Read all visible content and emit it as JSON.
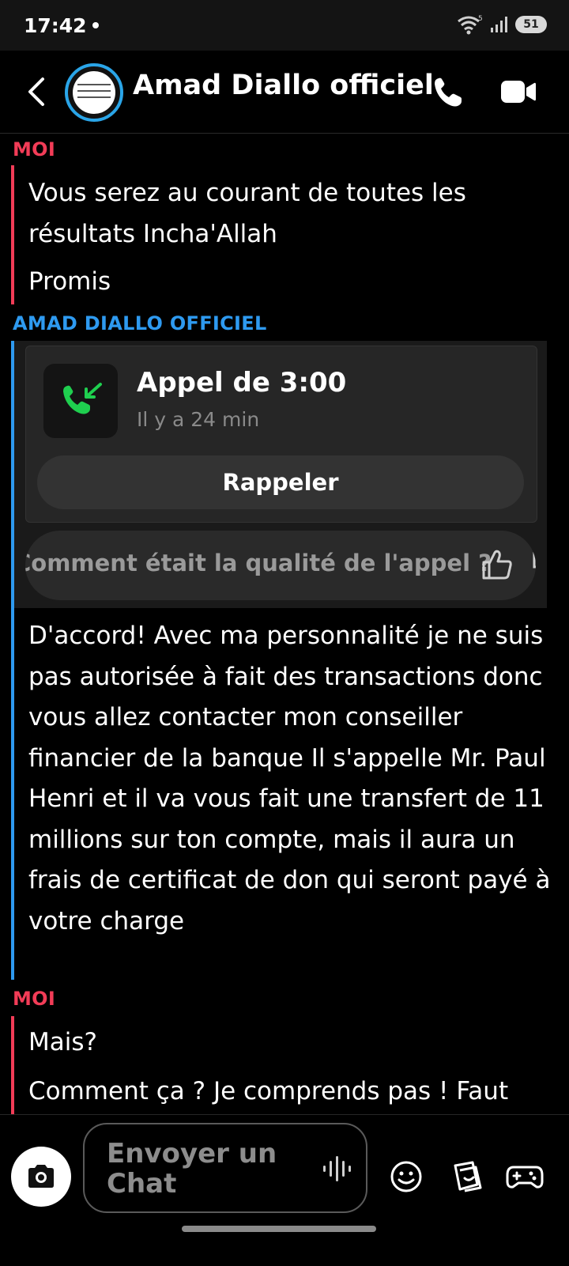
{
  "status_bar": {
    "time": "17:42",
    "battery": "51",
    "network_badge": "5"
  },
  "header": {
    "contact_name": "Amad Diallo officiel"
  },
  "messages": [
    {
      "sender": "MOI",
      "lines": [
        "Vous serez au courant de toutes les résultats Incha'Allah",
        "Promis"
      ]
    },
    {
      "sender": "AMAD DIALLO OFFICIEL",
      "call_card": {
        "title": "Appel de 3:00",
        "subtitle": "Il y a 24 min",
        "recall_label": "Rappeler",
        "rating_prompt": "Comment était la qualité de l'appel ?"
      },
      "text": "D'accord! Avec ma personnalité je ne suis pas autorisée à fait des transactions donc vous allez contacter mon conseiller financier de la banque Il s'appelle Mr. Paul Henri et il va vous fait une transfert de 11 millions sur ton compte, mais il aura un frais de certificat de don qui seront payé à votre charge"
    },
    {
      "sender": "MOI",
      "lines": [
        "Mais?",
        "Comment ça ? Je comprends pas ! Faut"
      ]
    }
  ],
  "composer": {
    "placeholder": "Envoyer un Chat"
  },
  "colors": {
    "me": "#f23c57",
    "them": "#2e9af0",
    "call_green": "#1fcf4f"
  },
  "icons": [
    "back-arrow-icon",
    "phone-icon",
    "video-icon",
    "camera-icon",
    "voice-icon",
    "emoji-icon",
    "sticker-icon",
    "game-controller-icon",
    "thumbs-up-icon"
  ]
}
